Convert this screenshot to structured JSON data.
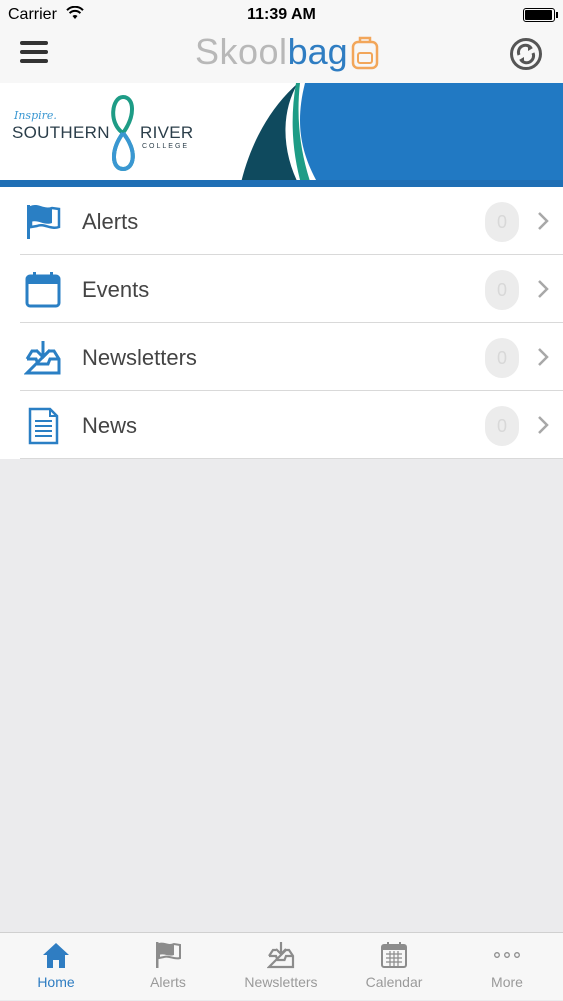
{
  "status_bar": {
    "carrier": "Carrier",
    "time": "11:39 AM"
  },
  "app": {
    "logo_part1": "Skool",
    "logo_part2": "bag",
    "brand_color": "#2f7dc2"
  },
  "banner": {
    "tagline": "Inspire.",
    "name_left": "SOUTHERN",
    "name_right": "RIVER",
    "subname": "COLLEGE",
    "bg_color": "#2179c3"
  },
  "menu": {
    "items": [
      {
        "label": "Alerts",
        "icon": "flag-icon",
        "count": "0"
      },
      {
        "label": "Events",
        "icon": "calendar-icon",
        "count": "0"
      },
      {
        "label": "Newsletters",
        "icon": "inbox-download-icon",
        "count": "0"
      },
      {
        "label": "News",
        "icon": "document-icon",
        "count": "0"
      }
    ]
  },
  "tabbar": {
    "tabs": [
      {
        "label": "Home",
        "icon": "home-icon",
        "active": true
      },
      {
        "label": "Alerts",
        "icon": "flag-icon",
        "active": false
      },
      {
        "label": "Newsletters",
        "icon": "inbox-download-icon",
        "active": false
      },
      {
        "label": "Calendar",
        "icon": "calendar-icon",
        "active": false
      },
      {
        "label": "More",
        "icon": "more-icon",
        "active": false
      }
    ]
  }
}
